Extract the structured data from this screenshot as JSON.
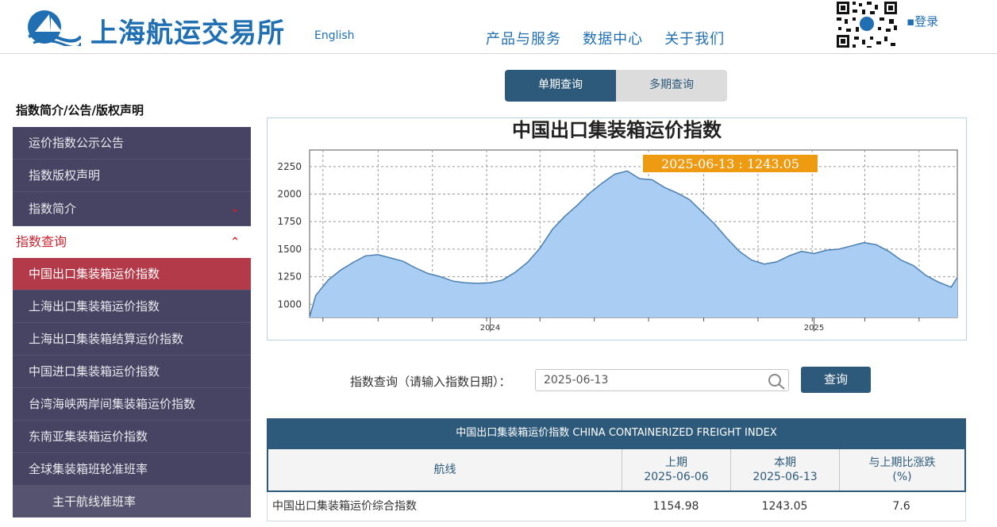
{
  "header": {
    "site_name": "上海航运交易所",
    "lang_link": "English",
    "nav": [
      "产品与服务",
      "数据中心",
      "关于我们"
    ],
    "login": "▪登录",
    "brand_color": "#1f6fb2"
  },
  "sidebar": {
    "head": "指数简介/公告/版权声明",
    "top_items": [
      "运价指数公示公告",
      "指数版权声明",
      "指数简介"
    ],
    "section": "指数查询",
    "items": [
      "中国出口集装箱运价指数",
      "上海出口集装箱运价指数",
      "上海出口集装箱结算运价指数",
      "中国进口集装箱运价指数",
      "台湾海峡两岸间集装箱运价指数",
      "东南亚集装箱运价指数",
      "全球集装箱班轮准班率"
    ],
    "sub_item": "主干航线准班率",
    "active_index": 0,
    "active_color": "#b33a49"
  },
  "tabs": [
    "单期查询",
    "多期查询"
  ],
  "chart_data": {
    "type": "area",
    "title": "中国出口集装箱运价指数",
    "tooltip": "2025-06-13 : 1243.05",
    "x_tick_labels": [
      "2024",
      "2025"
    ],
    "y_ticks": [
      1000,
      1250,
      1500,
      1750,
      2000,
      2250
    ],
    "ylim": [
      880,
      2400
    ],
    "grid": true,
    "fill_color": "#a9cdf3",
    "line_color": "#4a7fb0",
    "x": [
      "2023-06-16",
      "2023-06-23",
      "2023-07-07",
      "2023-07-21",
      "2023-08-04",
      "2023-08-18",
      "2023-09-01",
      "2023-09-15",
      "2023-09-29",
      "2023-10-13",
      "2023-10-27",
      "2023-11-10",
      "2023-11-24",
      "2023-12-08",
      "2023-12-22",
      "2024-01-05",
      "2024-01-19",
      "2024-02-02",
      "2024-02-16",
      "2024-03-01",
      "2024-03-15",
      "2024-03-29",
      "2024-04-12",
      "2024-04-26",
      "2024-05-10",
      "2024-05-24",
      "2024-06-07",
      "2024-06-21",
      "2024-07-05",
      "2024-07-19",
      "2024-08-02",
      "2024-08-16",
      "2024-08-30",
      "2024-09-13",
      "2024-09-27",
      "2024-10-11",
      "2024-10-25",
      "2024-11-08",
      "2024-11-22",
      "2024-12-06",
      "2024-12-20",
      "2025-01-03",
      "2025-01-17",
      "2025-01-31",
      "2025-02-14",
      "2025-02-28",
      "2025-03-14",
      "2025-03-28",
      "2025-04-11",
      "2025-04-25",
      "2025-05-09",
      "2025-05-23",
      "2025-06-06",
      "2025-06-13"
    ],
    "values": [
      885,
      1080,
      1220,
      1310,
      1380,
      1440,
      1450,
      1420,
      1390,
      1330,
      1280,
      1250,
      1210,
      1195,
      1190,
      1195,
      1220,
      1290,
      1380,
      1510,
      1680,
      1800,
      1900,
      2010,
      2100,
      2180,
      2210,
      2140,
      2130,
      2060,
      2010,
      1950,
      1840,
      1730,
      1600,
      1480,
      1400,
      1365,
      1385,
      1440,
      1480,
      1460,
      1490,
      1500,
      1530,
      1560,
      1540,
      1480,
      1400,
      1350,
      1260,
      1200,
      1154.98,
      1243.05
    ]
  },
  "query": {
    "label": "指数查询（请输入指数日期）：",
    "date_value": "2025-06-13",
    "button": "查询"
  },
  "table": {
    "title": "中国出口集装箱运价指数 CHINA CONTAINERIZED FREIGHT INDEX",
    "col_route": "航线",
    "col_prev": "上期",
    "prev_date": "2025-06-06",
    "col_curr": "本期",
    "curr_date": "2025-06-13",
    "col_change": "与上期比涨跌",
    "change_unit": "(%)",
    "rows": [
      {
        "route": "中国出口集装箱运价综合指数",
        "prev": "1154.98",
        "curr": "1243.05",
        "change": "7.6"
      }
    ]
  }
}
